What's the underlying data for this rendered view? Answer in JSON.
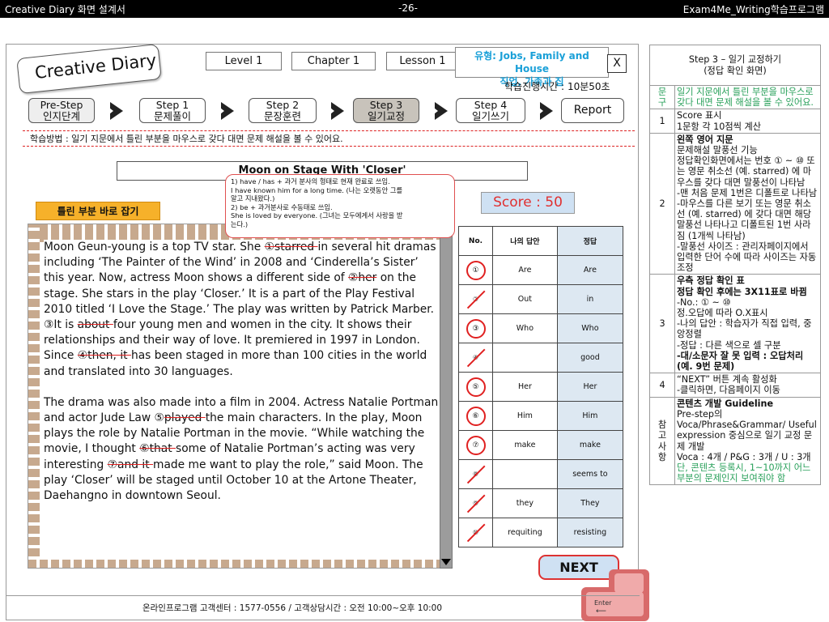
{
  "header": {
    "left": "Creative Diary 화면 설계서",
    "center": "-26-",
    "right": "Exam4Me_Writing학습프로그램"
  },
  "app": {
    "logo": "Creative Diary",
    "level": "Level 1",
    "chapter": "Chapter 1",
    "lesson": "Lesson 1",
    "type_line1": "유형: Jobs, Family and House",
    "type_line2": "직업, 가족과 집",
    "close": "X",
    "time_label": "학습진행시간 :",
    "time_value": "10분50초",
    "steps": [
      {
        "line1": "Pre-Step",
        "line2": "인지단계"
      },
      {
        "line1": "Step 1",
        "line2": "문제풀이"
      },
      {
        "line1": "Step 2",
        "line2": "문장훈련"
      },
      {
        "line1": "Step 3",
        "line2": "일기교정"
      },
      {
        "line1": "Step 4",
        "line2": "일기쓰기"
      },
      {
        "line1": "Report",
        "line2": ""
      }
    ],
    "study_method": "학습방법 : 일기 지문에서 틀린 부분을 마우스로 갖다 대면 문제 해설을 볼 수 있어요.",
    "passage_title": "Moon on Stage With 'Closer'",
    "wrong_tag": "틀린 부분 바로 잡기",
    "score": "Score : 50",
    "popup": [
      "1) have / has + 과거 분사의 형태로 현재 완료로 쓰임.",
      "I have known him for a long time. (나는 오랫동안 그를",
      "알고 지내왔다.)",
      "2) be + 과거분사로 수동태로 쓰임.",
      "She is loved by everyone. (그녀는 모두에게서 사랑을 받",
      "는다.)"
    ],
    "passage_p1": [
      {
        "t": "Moon Geun-young is a top TV star. She "
      },
      {
        "t": "①starred ",
        "wrong": true
      },
      {
        "t": "in several hit dramas including ‘The Painter of the Wind’ in 2008 and ‘Cinderella’s Sister’ this year.  Now, actress Moon shows a different side of "
      },
      {
        "t": "②her",
        "wrong": true
      },
      {
        "t": " on the stage. She stars in the play ‘Closer.’ It is a part of the Play Festival 2010 titled ‘I Love the Stage.’  The play was written by Patrick Marber. ③It is "
      },
      {
        "t": "about ",
        "wrong": true
      },
      {
        "t": "four young men and women in the city. It shows their relationships and their way of love. It premiered in 1997 in London. Since "
      },
      {
        "t": "④then, it ",
        "wrong": true
      },
      {
        "t": "has been staged in more than 100 cities in the world and translated into 30 languages."
      }
    ],
    "passage_p2": [
      {
        "t": "The drama was also made into a film in 2004. Actress Natalie Portman and actor Jude Law ⑤"
      },
      {
        "t": "played ",
        "wrong": true
      },
      {
        "t": "the main characters. In the play, Moon plays the role by Natalie Portman in the movie.  “While watching the movie, I thought "
      },
      {
        "t": "⑥that ",
        "wrong": true
      },
      {
        "t": "some of Natalie Portman’s acting was very interesting "
      },
      {
        "t": "⑦and it ",
        "wrong": true
      },
      {
        "t": "made me want to play the role,” said Moon.  The play ‘Closer’ will be staged until October 10 at the Artone Theater, Daehangno in downtown Seoul."
      }
    ],
    "table_headers": [
      "No.",
      "나의 답안",
      "정답"
    ],
    "table_rows": [
      {
        "no": "①",
        "mark": "O",
        "mine": "Are",
        "ans": "Are"
      },
      {
        "no": "②",
        "mark": "X",
        "mine": "Out",
        "ans": "in"
      },
      {
        "no": "③",
        "mark": "O",
        "mine": "Who",
        "ans": "Who"
      },
      {
        "no": "④",
        "mark": "X",
        "mine": "",
        "ans": "good"
      },
      {
        "no": "⑤",
        "mark": "O",
        "mine": "Her",
        "ans": "Her"
      },
      {
        "no": "⑥",
        "mark": "O",
        "mine": "Him",
        "ans": "Him"
      },
      {
        "no": "⑦",
        "mark": "O",
        "mine": "make",
        "ans": "make"
      },
      {
        "no": "⑧",
        "mark": "X",
        "mine": "",
        "ans": "seems to"
      },
      {
        "no": "⑨",
        "mark": "X",
        "mine": "they",
        "ans": "They"
      },
      {
        "no": "⑩",
        "mark": "X",
        "mine": "requiting",
        "ans": "resisting"
      }
    ],
    "next": "NEXT",
    "enter": "Enter",
    "footer": "온라인프로그램 고객센터 : 1577-0556   / 고객상담시간 : 오전 10:00~오후 10:00",
    "colors": {
      "accent_red": "#e02020",
      "score_bg": "#cfe1f3",
      "tag_orange": "#f6b12a",
      "annotation_green": "#28a05a"
    }
  },
  "annotations": {
    "header": "Step 3 – 일기 교정하기\n(정답 확인 화면)",
    "rows": [
      {
        "key": "문\n구",
        "key_green": true,
        "lines": [
          {
            "t": "일기 지문에서 틀린 부분을 마우스로 갖다 대면 문제 해설을 볼 수 있어요.",
            "cls": "green"
          }
        ]
      },
      {
        "key": "1",
        "lines": [
          {
            "t": "Score 표시"
          },
          {
            "t": "1문항 각 10점씩 계산"
          }
        ]
      },
      {
        "key": "2",
        "lines": [
          {
            "t": "왼쪽 영어 지문",
            "cls": "bold"
          },
          {
            "t": "문제해설 말풍선 기능"
          },
          {
            "t": "정답확인화면에서는 번호 ① ~ ⑩ 또는 영문 취소선 (예. starred) 에 마우스를 갖다 대면 말풍선이 나타남"
          },
          {
            "t": "-맨 처음 문제 1번은 디폴트로 나타남"
          },
          {
            "t": "-마우스를 다른 보기 또는 영문 취소선 (예. starred) 에 갖다 대면 해당 말풍선 나타나고 디폴트된 1번 사라짐 (1개씩 나타남)"
          },
          {
            "t": "-말풍선 사이즈 : 관리자페이지에서 입력한 단어 수에 따라 사이즈는 자동 조정"
          }
        ]
      },
      {
        "key": "3",
        "lines": [
          {
            "t": "우측 정답 확인 표",
            "cls": "bold"
          },
          {
            "t": "정답 확인 후에는 3X11표로 바뀜",
            "cls": "bold"
          },
          {
            "t": "-No.: ① ~ ⑩"
          },
          {
            "t": " 정.오답에 따라 O.X표시"
          },
          {
            "t": "-나의 답안 : 학습자가 직접 입력, 중앙정렬"
          },
          {
            "t": "-정답 : 다른 색으로 셀 구분"
          },
          {
            "t": "-대/소문자 잘 못 입력 : 오답처리 (예. 9번 문제)",
            "cls": "bold"
          }
        ]
      },
      {
        "key": "4",
        "lines": [
          {
            "t": "“NEXT” 버튼 계속 활성화"
          },
          {
            "t": "-클릭하면, 다음페이지 이동"
          }
        ]
      },
      {
        "key": "참\n고\n사\n항",
        "lines": [
          {
            "t": "콘텐츠 개발 Guideline",
            "cls": "bold"
          },
          {
            "t": "Pre-step의 Voca/Phrase&Grammar/ Useful expression 중심으로 일기 교정 문제 개발"
          },
          {
            "t": "Voca : 4개 / P&G : 3개 / U : 3개 "
          },
          {
            "t": "단, 콘텐츠 등록시, 1~10까지 어느 부분의 문제인지 보여줘야 함",
            "cls": "green"
          }
        ]
      }
    ]
  }
}
